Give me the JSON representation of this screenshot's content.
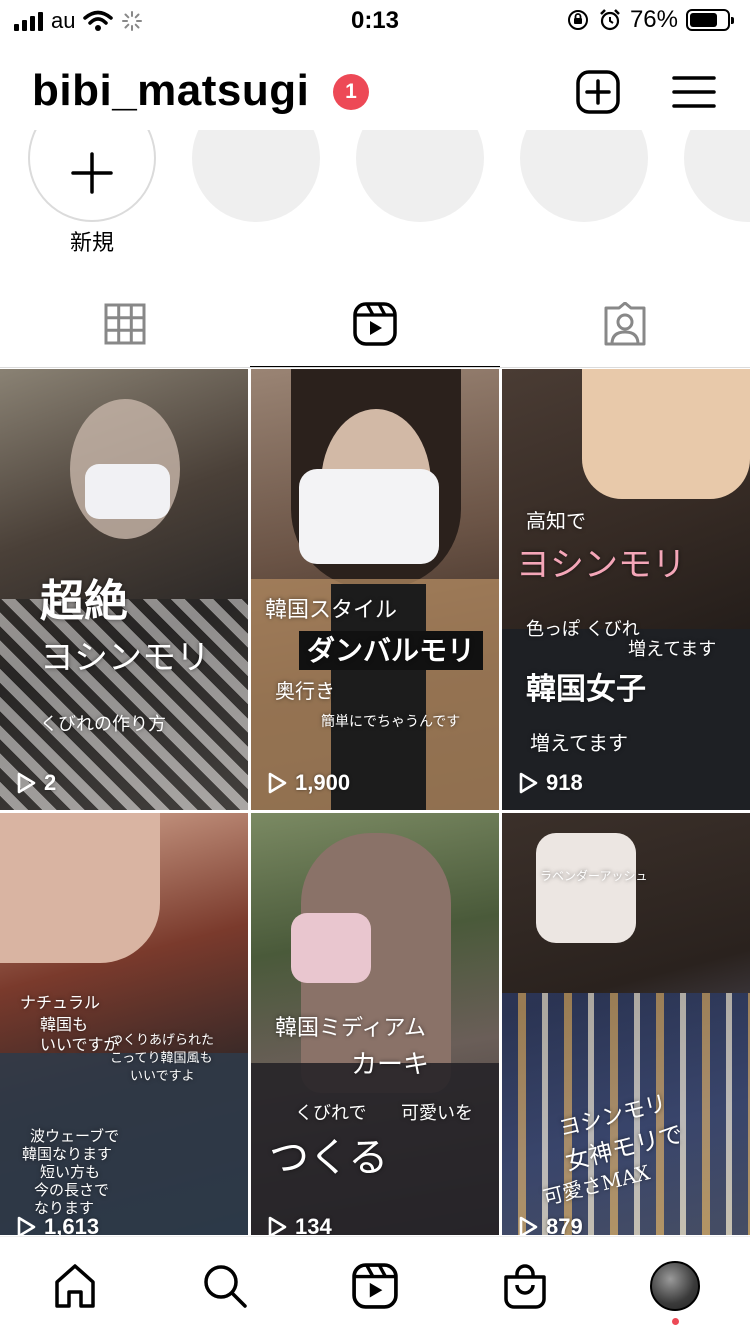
{
  "status_bar": {
    "carrier": "au",
    "time": "0:13",
    "battery": "76%",
    "battery_level": 0.76
  },
  "header": {
    "username": "bibi_matsugi",
    "notification_count": "1",
    "new_post_icon": "plus-square-icon",
    "menu_icon": "hamburger-menu-icon"
  },
  "highlights": {
    "new_label": "新規"
  },
  "tabs": [
    {
      "name": "grid",
      "icon": "grid-icon"
    },
    {
      "name": "reels",
      "icon": "reels-icon",
      "active": true
    },
    {
      "name": "tagged",
      "icon": "tagged-icon"
    }
  ],
  "reels": [
    {
      "views": "2",
      "captions": [
        "超絶",
        "ヨシンモリ",
        "くびれの作り方"
      ]
    },
    {
      "views": "1,900",
      "captions": [
        "韓国スタイル",
        "ダンバルモリ",
        "奥行き",
        "簡単にでちゃうんです"
      ]
    },
    {
      "views": "918",
      "captions": [
        "高知で",
        "ヨシンモリ",
        "色っぽ くびれ",
        "増えてます",
        "韓国女子",
        "増えてます"
      ]
    },
    {
      "views": "1,613",
      "captions": [
        "ナチュラル",
        "韓国も",
        "いいですが",
        "つくりあげられた",
        "こってり韓国風も",
        "いいですよ",
        "波ウェーブで",
        "韓国なります",
        "短い方も",
        "今の長さで",
        "なります"
      ]
    },
    {
      "views": "134",
      "captions": [
        "韓国ミディアム",
        "カーキ",
        "くびれで",
        "可愛いを",
        "つくる"
      ]
    },
    {
      "views": "879",
      "captions": [
        "ラベンダーアッシュ",
        "ヨシンモリ",
        "女神モリで",
        "可愛さMAX"
      ]
    }
  ],
  "nav": {
    "items": [
      "home-icon",
      "search-icon",
      "reels-icon",
      "shop-icon",
      "profile-avatar"
    ]
  }
}
